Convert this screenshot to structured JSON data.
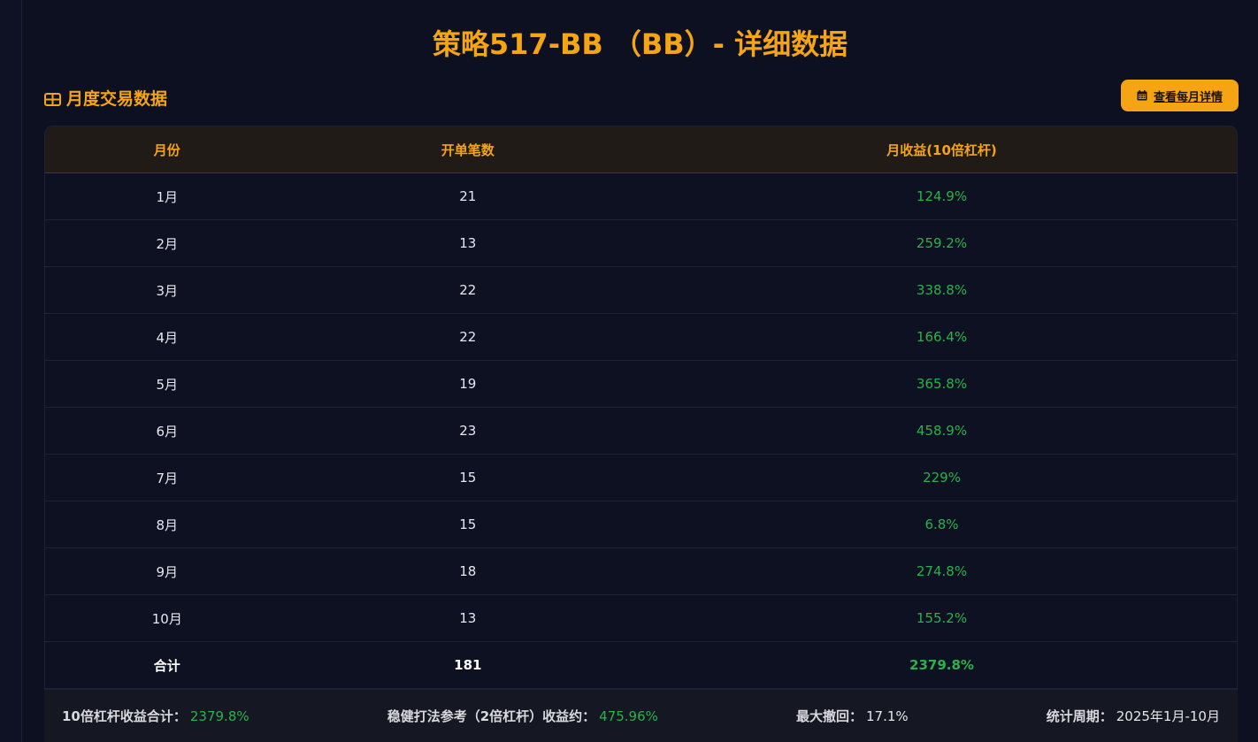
{
  "page": {
    "title": "策略517-BB （BB）- 详细数据"
  },
  "section": {
    "title": "月度交易数据",
    "detail_button": "查看每月详情"
  },
  "table": {
    "headers": [
      "月份",
      "开单笔数",
      "月收益(10倍杠杆)"
    ],
    "rows": [
      {
        "month": "1月",
        "count": "21",
        "ret": "124.9%"
      },
      {
        "month": "2月",
        "count": "13",
        "ret": "259.2%"
      },
      {
        "month": "3月",
        "count": "22",
        "ret": "338.8%"
      },
      {
        "month": "4月",
        "count": "22",
        "ret": "166.4%"
      },
      {
        "month": "5月",
        "count": "19",
        "ret": "365.8%"
      },
      {
        "month": "6月",
        "count": "23",
        "ret": "458.9%"
      },
      {
        "month": "7月",
        "count": "15",
        "ret": "229%"
      },
      {
        "month": "8月",
        "count": "15",
        "ret": "6.8%"
      },
      {
        "month": "9月",
        "count": "18",
        "ret": "274.8%"
      },
      {
        "month": "10月",
        "count": "13",
        "ret": "155.2%"
      }
    ],
    "total": {
      "month": "合计",
      "count": "181",
      "ret": "2379.8%"
    }
  },
  "footer": {
    "total_label": "10倍杠杆收益合计：",
    "total_value": "2379.8%",
    "safe_label": "稳健打法参考（2倍杠杆）收益约：",
    "safe_value": "475.96%",
    "drawdown_label": "最大撤回：",
    "drawdown_value": "17.1%",
    "period_label": "统计周期：",
    "period_value": "2025年1月-10月"
  },
  "colors": {
    "accent": "#f5a414",
    "positive": "#2ab24a",
    "background": "#0c1020"
  },
  "icons": {
    "section": "table-icon",
    "button": "calendar-icon"
  }
}
